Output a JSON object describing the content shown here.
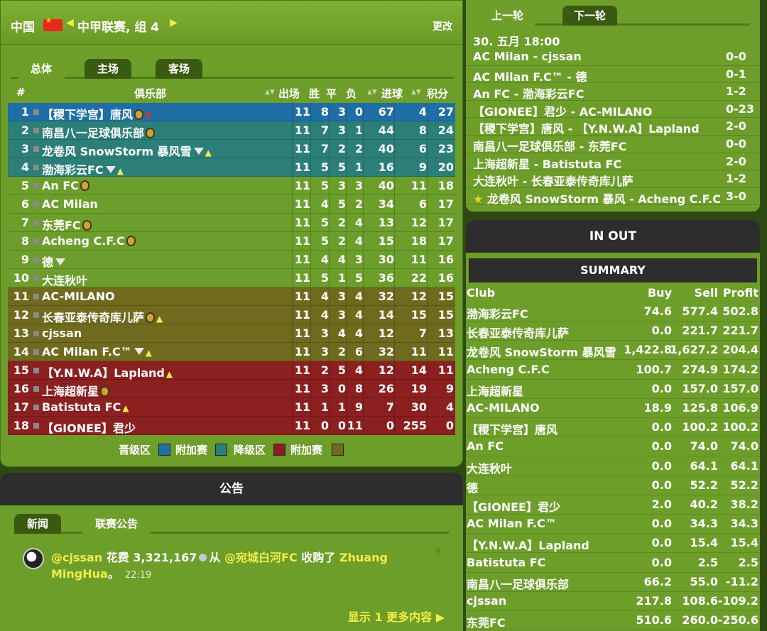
{
  "header": {
    "country": "中国",
    "league": "中甲联赛, 组 4",
    "change_label": "更改",
    "prev_arrow": "◀",
    "next_arrow": "▶"
  },
  "league_tabs": [
    "总体",
    "主场",
    "客场"
  ],
  "standings": {
    "columns": {
      "pos": "#",
      "club": "俱乐部",
      "played": "出场",
      "won": "胜",
      "drawn": "平",
      "lost": "负",
      "goals": "进球",
      "points": "积分"
    },
    "rows": [
      {
        "pos": "1",
        "club": "【稷下学宫】唐风",
        "badge": true,
        "gem": false,
        "trend": "down",
        "p": "11",
        "w": "8",
        "d": "3",
        "l": "0",
        "gf": "67",
        "ga": "4",
        "pts": "27",
        "zone": "promo"
      },
      {
        "pos": "2",
        "club": "南昌八一足球俱乐部",
        "badge": true,
        "gem": false,
        "trend": "",
        "p": "11",
        "w": "7",
        "d": "3",
        "l": "1",
        "gf": "44",
        "ga": "8",
        "pts": "24",
        "zone": "po1"
      },
      {
        "pos": "3",
        "club": "龙卷风 SnowStorm 暴风雪",
        "badge": false,
        "gem": true,
        "trend": "up",
        "p": "11",
        "w": "7",
        "d": "2",
        "l": "2",
        "gf": "40",
        "ga": "6",
        "pts": "23",
        "zone": "po1"
      },
      {
        "pos": "4",
        "club": "渤海彩云FC",
        "badge": false,
        "gem": true,
        "trend": "up",
        "p": "11",
        "w": "5",
        "d": "5",
        "l": "1",
        "gf": "16",
        "ga": "9",
        "pts": "20",
        "zone": "po1"
      },
      {
        "pos": "5",
        "club": "An FC",
        "badge": true,
        "gem": false,
        "trend": "",
        "p": "11",
        "w": "5",
        "d": "3",
        "l": "3",
        "gf": "40",
        "ga": "11",
        "pts": "18",
        "zone": "normal"
      },
      {
        "pos": "6",
        "club": "AC Milan",
        "badge": false,
        "gem": false,
        "trend": "",
        "p": "11",
        "w": "4",
        "d": "5",
        "l": "2",
        "gf": "34",
        "ga": "6",
        "pts": "17",
        "zone": "normal"
      },
      {
        "pos": "7",
        "club": "东莞FC",
        "badge": true,
        "gem": false,
        "trend": "",
        "p": "11",
        "w": "5",
        "d": "2",
        "l": "4",
        "gf": "13",
        "ga": "12",
        "pts": "17",
        "zone": "normal"
      },
      {
        "pos": "8",
        "club": "Acheng C.F.C",
        "badge": true,
        "gem": false,
        "trend": "",
        "p": "11",
        "w": "5",
        "d": "2",
        "l": "4",
        "gf": "15",
        "ga": "18",
        "pts": "17",
        "zone": "normal"
      },
      {
        "pos": "9",
        "club": "德",
        "badge": false,
        "gem": true,
        "trend": "",
        "p": "11",
        "w": "4",
        "d": "4",
        "l": "3",
        "gf": "30",
        "ga": "11",
        "pts": "16",
        "zone": "normal"
      },
      {
        "pos": "10",
        "club": "大连秋叶",
        "badge": false,
        "gem": false,
        "trend": "",
        "p": "11",
        "w": "5",
        "d": "1",
        "l": "5",
        "gf": "36",
        "ga": "22",
        "pts": "16",
        "zone": "normal"
      },
      {
        "pos": "11",
        "club": "AC-MILANO",
        "badge": false,
        "gem": false,
        "trend": "",
        "p": "11",
        "w": "4",
        "d": "3",
        "l": "4",
        "gf": "32",
        "ga": "12",
        "pts": "15",
        "zone": "po2"
      },
      {
        "pos": "12",
        "club": "长春亚泰传奇库儿萨",
        "badge": true,
        "gem": false,
        "trend": "up",
        "p": "11",
        "w": "4",
        "d": "3",
        "l": "4",
        "gf": "14",
        "ga": "15",
        "pts": "15",
        "zone": "po2"
      },
      {
        "pos": "13",
        "club": "cjssan",
        "badge": false,
        "gem": false,
        "trend": "",
        "p": "11",
        "w": "3",
        "d": "4",
        "l": "4",
        "gf": "12",
        "ga": "7",
        "pts": "13",
        "zone": "po2"
      },
      {
        "pos": "14",
        "club": "AC Milan F.C™",
        "badge": false,
        "gem": true,
        "trend": "up",
        "p": "11",
        "w": "3",
        "d": "2",
        "l": "6",
        "gf": "32",
        "ga": "11",
        "pts": "11",
        "zone": "po2"
      },
      {
        "pos": "15",
        "club": "【Y.N.W.A】Lapland",
        "badge": false,
        "gem": false,
        "trend": "up",
        "p": "11",
        "w": "2",
        "d": "5",
        "l": "4",
        "gf": "12",
        "ga": "14",
        "pts": "11",
        "zone": "rel"
      },
      {
        "pos": "16",
        "club": "上海超新星",
        "badge": true,
        "gem": false,
        "trend": "",
        "p": "11",
        "w": "3",
        "d": "0",
        "l": "8",
        "gf": "26",
        "ga": "19",
        "pts": "9",
        "zone": "rel"
      },
      {
        "pos": "17",
        "club": "Batistuta FC",
        "badge": false,
        "gem": false,
        "trend": "up",
        "p": "11",
        "w": "1",
        "d": "1",
        "l": "9",
        "gf": "7",
        "ga": "30",
        "pts": "4",
        "zone": "rel"
      },
      {
        "pos": "18",
        "club": "【GIONEE】君少",
        "badge": false,
        "gem": false,
        "trend": "",
        "p": "11",
        "w": "0",
        "d": "0",
        "l": "11",
        "gf": "0",
        "ga": "255",
        "pts": "0",
        "zone": "rel"
      }
    ]
  },
  "legend": [
    {
      "label": "晋级区",
      "color": "#1f6fa6"
    },
    {
      "label": "附加赛",
      "color": "#2b7f78"
    },
    {
      "label": "降级区",
      "color": "#8c1f1f"
    },
    {
      "label": "附加赛",
      "color": "#6f6a1e"
    }
  ],
  "announce": {
    "title": "公告",
    "tabs": [
      "新闻",
      "联赛公告"
    ],
    "feed": {
      "user": "@cjssan",
      "spent": "花费 3,321,167",
      "from_word": "从",
      "from_club": "@宛城白河FC",
      "bought": "收购了",
      "player": "Zhuang MingHua",
      "period": "。",
      "time": "22:19"
    },
    "show_more": "显示 1 更多内容 ▶"
  },
  "round": {
    "tabs": [
      "上一轮",
      "下一轮"
    ],
    "date": "30. 五月 18:00",
    "matches": [
      {
        "teams": "AC Milan - cjssan",
        "score": "0-0",
        "star": false
      },
      {
        "teams": "AC Milan F.C™ - 德",
        "score": "0-1",
        "star": false
      },
      {
        "teams": "An FC - 渤海彩云FC",
        "score": "1-2",
        "star": false
      },
      {
        "teams": "【GIONEE】君少 - AC-MILANO",
        "score": "0-23",
        "star": false
      },
      {
        "teams": "【稷下学宫】唐风 - 【Y.N.W.A】Lapland",
        "score": "2-0",
        "star": false
      },
      {
        "teams": "南昌八一足球俱乐部 - 东莞FC",
        "score": "0-0",
        "star": false
      },
      {
        "teams": "上海超新星 - Batistuta FC",
        "score": "2-0",
        "star": false
      },
      {
        "teams": "大连秋叶 - 长春亚泰传奇库儿萨",
        "score": "1-2",
        "star": false
      },
      {
        "teams": "龙卷风 SnowStorm 暴风 - Acheng C.F.C",
        "score": "3-0",
        "star": true
      }
    ]
  },
  "inout": {
    "title": "IN OUT",
    "summary_title": "SUMMARY",
    "columns": {
      "club": "Club",
      "buy": "Buy",
      "sell": "Sell",
      "profit": "Profit"
    },
    "rows": [
      {
        "club": "渤海彩云FC",
        "buy": "74.6",
        "sell": "577.4",
        "profit": "502.8"
      },
      {
        "club": "长春亚泰传奇库儿萨",
        "buy": "0.0",
        "sell": "221.7",
        "profit": "221.7"
      },
      {
        "club": "龙卷风 SnowStorm 暴风雪",
        "buy": "1,422.8",
        "sell": "1,627.2",
        "profit": "204.4"
      },
      {
        "club": "Acheng C.F.C",
        "buy": "100.7",
        "sell": "274.9",
        "profit": "174.2"
      },
      {
        "club": "上海超新星",
        "buy": "0.0",
        "sell": "157.0",
        "profit": "157.0"
      },
      {
        "club": "AC-MILANO",
        "buy": "18.9",
        "sell": "125.8",
        "profit": "106.9"
      },
      {
        "club": "【稷下学宫】唐风",
        "buy": "0.0",
        "sell": "100.2",
        "profit": "100.2"
      },
      {
        "club": "An FC",
        "buy": "0.0",
        "sell": "74.0",
        "profit": "74.0"
      },
      {
        "club": "大连秋叶",
        "buy": "0.0",
        "sell": "64.1",
        "profit": "64.1"
      },
      {
        "club": "德",
        "buy": "0.0",
        "sell": "52.2",
        "profit": "52.2"
      },
      {
        "club": "【GIONEE】君少",
        "buy": "2.0",
        "sell": "40.2",
        "profit": "38.2"
      },
      {
        "club": "AC Milan F.C™",
        "buy": "0.0",
        "sell": "34.3",
        "profit": "34.3"
      },
      {
        "club": "【Y.N.W.A】Lapland",
        "buy": "0.0",
        "sell": "15.4",
        "profit": "15.4"
      },
      {
        "club": "Batistuta FC",
        "buy": "0.0",
        "sell": "2.5",
        "profit": "2.5"
      },
      {
        "club": "南昌八一足球俱乐部",
        "buy": "66.2",
        "sell": "55.0",
        "profit": "-11.2"
      },
      {
        "club": "cjssan",
        "buy": "217.8",
        "sell": "108.6",
        "profit": "-109.2"
      },
      {
        "club": "东莞FC",
        "buy": "510.6",
        "sell": "260.0",
        "profit": "-250.6"
      }
    ]
  }
}
